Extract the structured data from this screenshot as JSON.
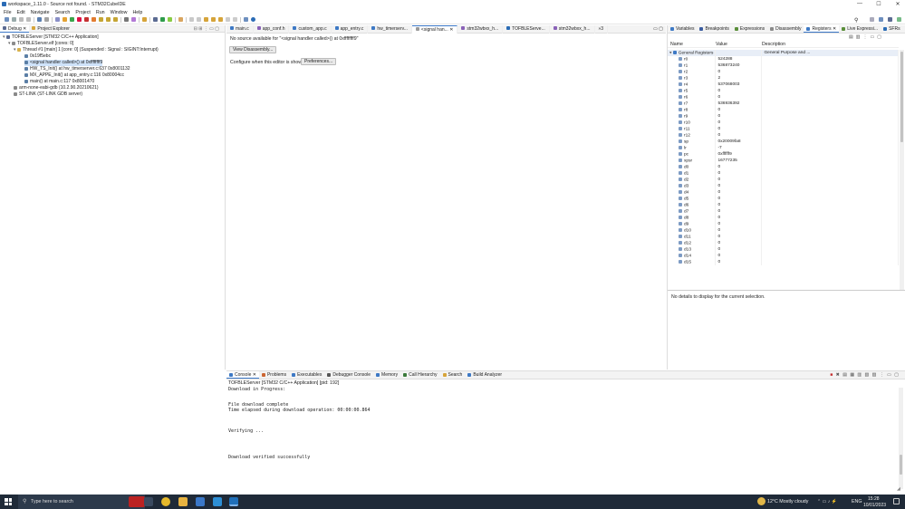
{
  "window": {
    "title": "workspace_1.11.0 - Source not found. - STM32CubeIDE",
    "min": "—",
    "max": "☐",
    "close": "✕"
  },
  "menu": [
    "File",
    "Edit",
    "Navigate",
    "Search",
    "Project",
    "Run",
    "Window",
    "Help"
  ],
  "left_panel": {
    "tabs": [
      "Debug",
      "Project Explorer"
    ],
    "tree": [
      {
        "label": "TOFBLEServer [STM32 C/C++ Application]"
      },
      {
        "label": "TOFBLEServer.elf [cores: 0]"
      },
      {
        "label": "Thread #1 [main] 1 [core: 0] (Suspended : Signal : SIGINT:Interrupt)"
      },
      {
        "label": "0x19f5ebc"
      },
      {
        "label": "<signal handler called>() at 0xffffffff9"
      },
      {
        "label": "HW_TS_Init() at hw_timerserver.c:637 0x8001132"
      },
      {
        "label": "MX_APPE_Init() at app_entry.c:116 0x80004cc"
      },
      {
        "label": "main() at main.c:117 0x8001470"
      },
      {
        "label": "arm-none-eabi-gdb (10.2.90.20210621)"
      },
      {
        "label": "ST-LINK (ST-LINK GDB server)"
      }
    ]
  },
  "editor": {
    "tabs": [
      "main.c",
      "app_conf.h",
      "custom_app.c",
      "app_entry.c",
      "hw_timerserv...",
      "<signal han...",
      "stm32wbxx_h...",
      "TOFBLEServe...",
      "stm32wbxx_h...",
      "»3"
    ],
    "active_tab_index": 5,
    "no_source_msg": "No source available for \"<signal handler called>() at 0xffffffff9\"",
    "view_disassembly": "View Disassembly...",
    "configure_msg": "Configure when this editor is shown",
    "preferences": "Preferences..."
  },
  "right_panel": {
    "tabs": [
      "Variables",
      "Breakpoints",
      "Expressions",
      "Disassembly",
      "Registers",
      "Live Expressi...",
      "SFRs"
    ],
    "active_tab_index": 4,
    "columns": [
      "Name",
      "Value",
      "Description"
    ],
    "group": {
      "name": "General Registers",
      "description": "General Purpose and ..."
    },
    "registers": [
      {
        "name": "r0",
        "value": "524288"
      },
      {
        "name": "r1",
        "value": "536873240"
      },
      {
        "name": "r2",
        "value": "0"
      },
      {
        "name": "r3",
        "value": "2"
      },
      {
        "name": "r4",
        "value": "537068003"
      },
      {
        "name": "r5",
        "value": "0"
      },
      {
        "name": "r6",
        "value": "0"
      },
      {
        "name": "r7",
        "value": "536936392"
      },
      {
        "name": "r8",
        "value": "0"
      },
      {
        "name": "r9",
        "value": "0"
      },
      {
        "name": "r10",
        "value": "0"
      },
      {
        "name": "r11",
        "value": "0"
      },
      {
        "name": "r12",
        "value": "0"
      },
      {
        "name": "sp",
        "value": "0x20009fa8"
      },
      {
        "name": "lr",
        "value": "-7"
      },
      {
        "name": "pc",
        "value": "0xffffff9"
      },
      {
        "name": "xpsr",
        "value": "16777235"
      },
      {
        "name": "d0",
        "value": "0"
      },
      {
        "name": "d1",
        "value": "0"
      },
      {
        "name": "d2",
        "value": "0"
      },
      {
        "name": "d3",
        "value": "0"
      },
      {
        "name": "d4",
        "value": "0"
      },
      {
        "name": "d5",
        "value": "0"
      },
      {
        "name": "d6",
        "value": "0"
      },
      {
        "name": "d7",
        "value": "0"
      },
      {
        "name": "d8",
        "value": "0"
      },
      {
        "name": "d9",
        "value": "0"
      },
      {
        "name": "d10",
        "value": "0"
      },
      {
        "name": "d11",
        "value": "0"
      },
      {
        "name": "d12",
        "value": "0"
      },
      {
        "name": "d13",
        "value": "0"
      },
      {
        "name": "d14",
        "value": "0"
      },
      {
        "name": "d15",
        "value": "0"
      }
    ],
    "details_msg": "No details to display for the current selection."
  },
  "console": {
    "tabs": [
      "Console",
      "Problems",
      "Executables",
      "Debugger Console",
      "Memory",
      "Call Hierarchy",
      "Search",
      "Build Analyzer"
    ],
    "header": "TOFBLEServer [STM32 C/C++ Application] [pid: 192]",
    "lines": [
      "Download in Progress:",
      "",
      "",
      "File download complete",
      "Time elapsed during download operation: 00:00:00.864",
      "",
      "",
      "",
      "Verifying ...",
      "",
      "",
      "",
      "",
      "Download verified successfully"
    ]
  },
  "taskbar": {
    "search_placeholder": "Type here to search",
    "weather": "12°C  Mostly cloudy",
    "lang": "ENG",
    "time": "15:28",
    "date": "10/01/2023"
  },
  "colors": {
    "accent": "#3c78c8",
    "selection": "#cfe3fa",
    "taskbar": "#1f2a38"
  }
}
